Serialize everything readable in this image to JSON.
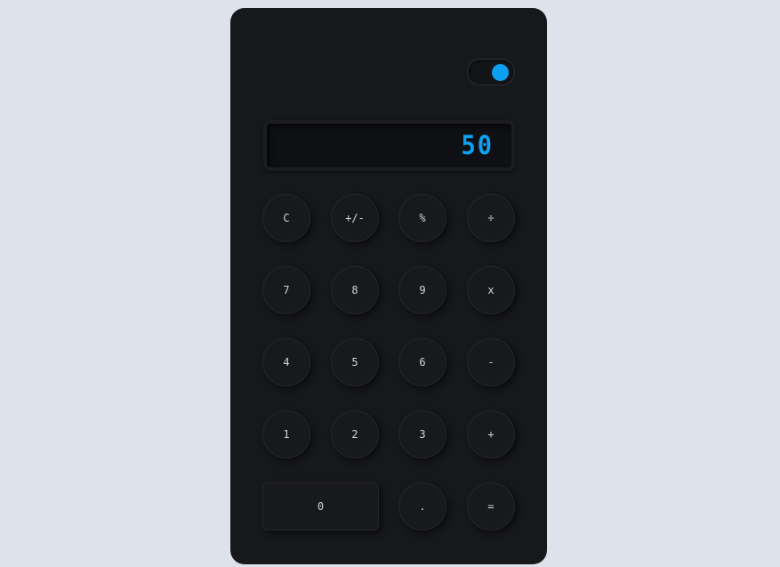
{
  "theme_toggle": {
    "state": "on",
    "knob_color": "#0da0f0"
  },
  "display": {
    "value": "50",
    "color": "#0da0f0"
  },
  "keys": {
    "clear": "C",
    "sign": "+/-",
    "percent": "%",
    "divide": "÷",
    "seven": "7",
    "eight": "8",
    "nine": "9",
    "multiply": "x",
    "four": "4",
    "five": "5",
    "six": "6",
    "subtract": "-",
    "one": "1",
    "two": "2",
    "three": "3",
    "add": "+",
    "zero": "0",
    "decimal": ".",
    "equals": "="
  }
}
